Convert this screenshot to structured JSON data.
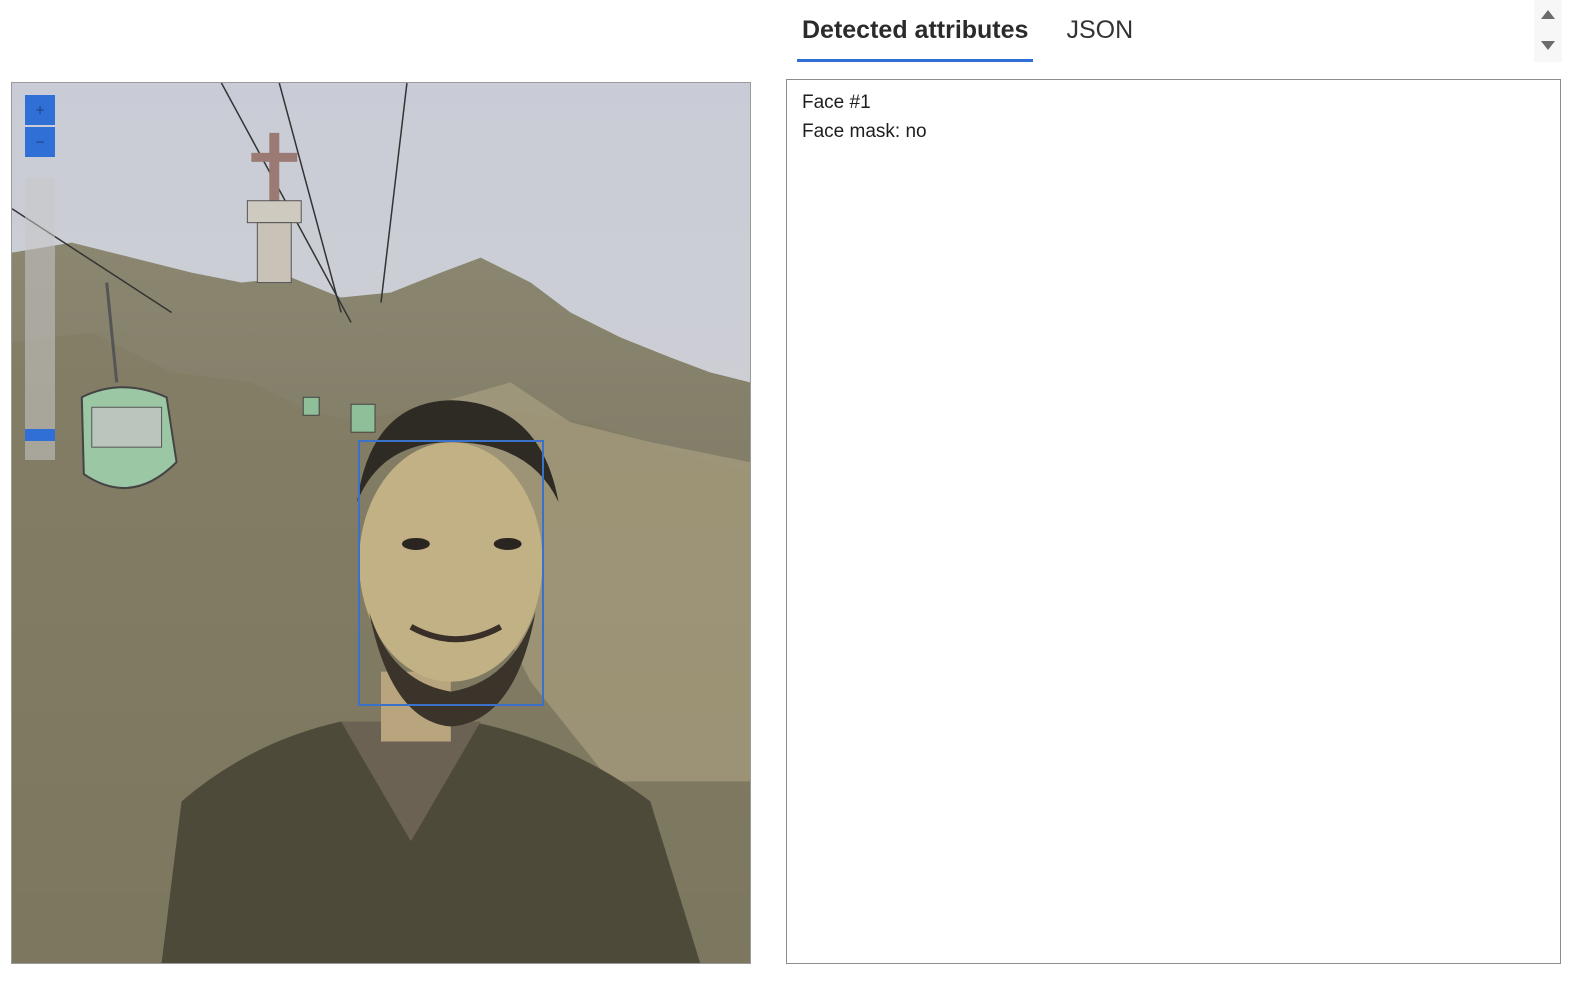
{
  "tabs": [
    {
      "label": "Detected attributes",
      "active": true
    },
    {
      "label": "JSON",
      "active": false
    }
  ],
  "viewer": {
    "zoom_in_label": "+",
    "zoom_out_label": "−",
    "zoom_level": 0.07,
    "accent_color": "#2f6fd6",
    "face_box_color": "#3b72c9"
  },
  "results": {
    "face_title": "Face #1",
    "face_mask_line": "Face mask: no"
  },
  "icons": {
    "scroll_up": "arrow-up-icon",
    "scroll_down": "arrow-down-icon"
  }
}
